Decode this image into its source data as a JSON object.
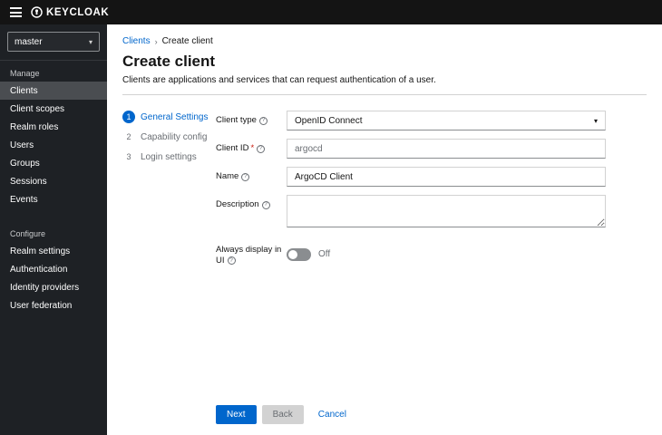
{
  "icons": {
    "help": "?",
    "caret": "▾",
    "breadcrumb_separator": "›"
  },
  "topbar": {
    "brand": "KEYCLOAK"
  },
  "sidebar": {
    "realm_selector": "master",
    "sections": [
      {
        "label": "Manage",
        "items": [
          {
            "label": "Clients"
          },
          {
            "label": "Client scopes"
          },
          {
            "label": "Realm roles"
          },
          {
            "label": "Users"
          },
          {
            "label": "Groups"
          },
          {
            "label": "Sessions"
          },
          {
            "label": "Events"
          }
        ]
      },
      {
        "label": "Configure",
        "items": [
          {
            "label": "Realm settings"
          },
          {
            "label": "Authentication"
          },
          {
            "label": "Identity providers"
          },
          {
            "label": "User federation"
          }
        ]
      }
    ]
  },
  "breadcrumb": {
    "parent": "Clients",
    "current": "Create client"
  },
  "page": {
    "title": "Create client",
    "subtitle": "Clients are applications and services that can request authentication of a user."
  },
  "wizard": [
    {
      "number": "1",
      "label": "General Settings"
    },
    {
      "number": "2",
      "label": "Capability config"
    },
    {
      "number": "3",
      "label": "Login settings"
    }
  ],
  "form": {
    "client_type": {
      "label": "Client type",
      "value": "OpenID Connect"
    },
    "client_id": {
      "label": "Client ID",
      "required_marker": "*",
      "value": "argocd"
    },
    "name": {
      "label": "Name",
      "value": "ArgoCD Client"
    },
    "description": {
      "label": "Description"
    },
    "always_display": {
      "label": "Always display in UI",
      "state_label": "Off"
    }
  },
  "actions": {
    "next": "Next",
    "back": "Back",
    "cancel": "Cancel"
  }
}
